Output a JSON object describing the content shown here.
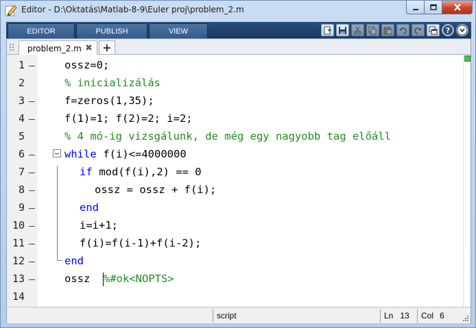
{
  "window": {
    "title": "Editor - D:\\Oktatás\\Matlab-8-9\\Euler proj\\problem_2.m",
    "icon": "pencil-edit-icon"
  },
  "toolstrip": {
    "tabs": [
      "EDITOR",
      "PUBLISH",
      "VIEW"
    ],
    "quick_icons": [
      "new-file-icon",
      "save-icon",
      "cut-icon",
      "copy-icon",
      "paste-icon",
      "undo-icon",
      "redo-icon",
      "switch-windows-icon",
      "help-icon",
      "expand-icon"
    ]
  },
  "file_tabs": {
    "active": "problem_2.m",
    "close_glyph": "✖",
    "add_glyph": "+"
  },
  "code": {
    "lines": [
      {
        "n": "1",
        "dash": true
      },
      {
        "n": "2",
        "dash": false
      },
      {
        "n": "3",
        "dash": true
      },
      {
        "n": "4",
        "dash": true
      },
      {
        "n": "5",
        "dash": false
      },
      {
        "n": "6",
        "dash": true
      },
      {
        "n": "7",
        "dash": true
      },
      {
        "n": "8",
        "dash": true
      },
      {
        "n": "9",
        "dash": true
      },
      {
        "n": "10",
        "dash": true
      },
      {
        "n": "11",
        "dash": true
      },
      {
        "n": "12",
        "dash": true
      },
      {
        "n": "13",
        "dash": true
      },
      {
        "n": "14",
        "dash": false
      }
    ],
    "l1": "ossz=0;",
    "l2": "% inicializálás",
    "l3": "f=zeros(1,35);",
    "l4": "f(1)=1; f(2)=2; i=2;",
    "l5": "% 4 mó-ig vizsgálunk, de még egy nagyobb tag előáll",
    "l6_kw": "while",
    "l6_rest": " f(i)<=4000000",
    "l7_kw": "if",
    "l7_rest": " mod(f(i),2) == 0",
    "l8": "ossz = ossz + f(i);",
    "l9_kw": "end",
    "l10": "i=i+1;",
    "l11": "f(i)=f(i-1)+f(i-2);",
    "l12_kw": "end",
    "l13_code": "ossz ",
    "l13_comment": "%#ok<NOPTS>"
  },
  "status": {
    "mode": "script",
    "ln_label": "Ln",
    "ln_value": "13",
    "col_label": "Col",
    "col_value": "6"
  },
  "colors": {
    "keyword": "#0000ff",
    "comment": "#228b22",
    "code_analyzer_ok": "#47c04a"
  }
}
